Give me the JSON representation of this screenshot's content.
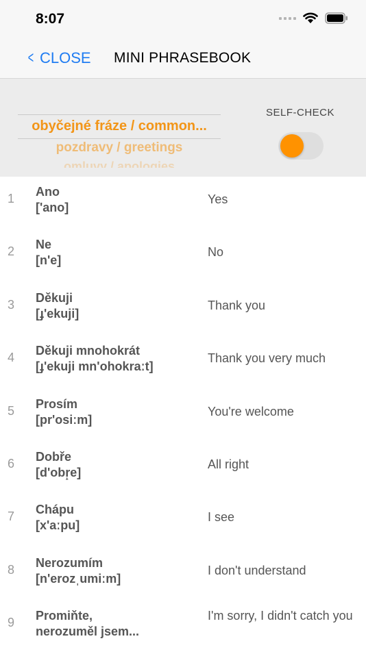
{
  "status": {
    "time": "8:07"
  },
  "nav": {
    "back_label": "CLOSE",
    "title": "MINI PHRASEBOOK"
  },
  "controls": {
    "categories": [
      "obyčejné fráze / common...",
      "pozdravy / greetings",
      "omluvy / apologies"
    ],
    "selected_category": "obyčejné fráze / common...",
    "self_check_label": "SELF-CHECK",
    "self_check_on": true,
    "accent_color": "#ff9200"
  },
  "phrases": [
    {
      "num": "1",
      "czech": "Ano",
      "phonetic": "['ano]",
      "english": "Yes"
    },
    {
      "num": "2",
      "czech": "Ne",
      "phonetic": "[n'e]",
      "english": "No"
    },
    {
      "num": "3",
      "czech": "Děkuji",
      "phonetic": "[ɟ'ekuji]",
      "english": "Thank you"
    },
    {
      "num": "4",
      "czech": "Děkuji mnohokrát",
      "phonetic": "[ɟ'ekuji mn'ohokraːt]",
      "english": "Thank you very much"
    },
    {
      "num": "5",
      "czech": "Prosím",
      "phonetic": "[pr'osiːm]",
      "english": "You're welcome"
    },
    {
      "num": "6",
      "czech": "Dobře",
      "phonetic": "[d'obr̝e]",
      "english": "All right"
    },
    {
      "num": "7",
      "czech": "Chápu",
      "phonetic": "[x'aːpu]",
      "english": "I see"
    },
    {
      "num": "8",
      "czech": "Nerozumím",
      "phonetic": "[n'erozˌumiːm]",
      "english": "I don't understand"
    },
    {
      "num": "9",
      "czech": "Promiňte,",
      "phonetic": "nerozuměl jsem...",
      "english": "I'm sorry, I didn't catch you"
    }
  ]
}
